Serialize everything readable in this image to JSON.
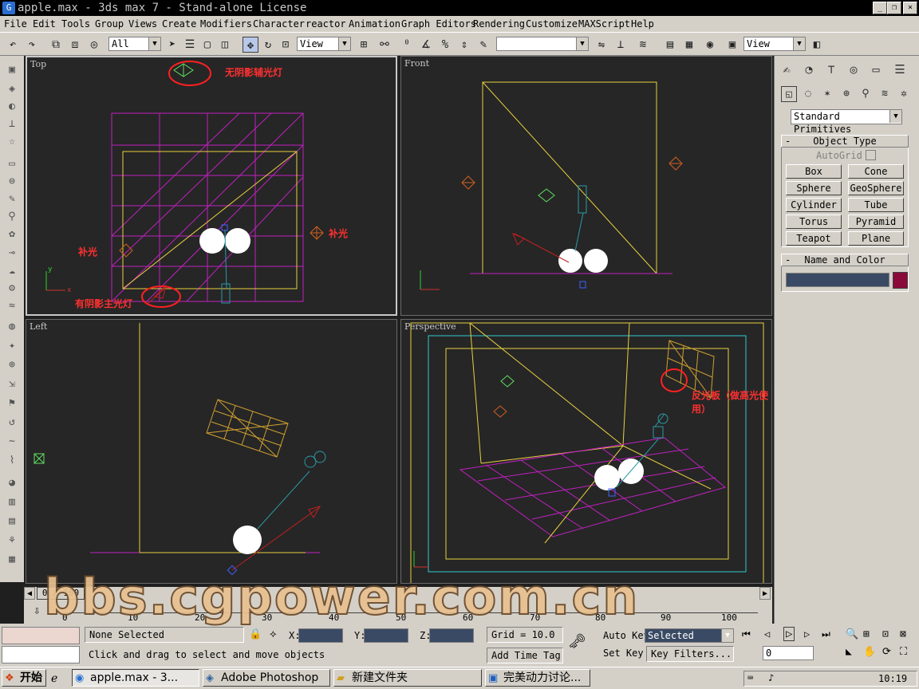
{
  "window": {
    "title": "apple.max - 3ds max 7  - Stand-alone License",
    "controls": {
      "minimize": "_",
      "restore": "❐",
      "close": "×"
    }
  },
  "menu": [
    "File",
    "Edit",
    "Tools",
    "Group",
    "Views",
    "Create",
    "Modifiers",
    "Character",
    "reactor",
    "Animation",
    "Graph Editors",
    "Rendering",
    "Customize",
    "MAXScript",
    "Help"
  ],
  "toolbar": {
    "selection_filter": "All",
    "ref_coord_1": "View",
    "named_selection": "",
    "ref_coord_2": "View"
  },
  "viewports": {
    "top": {
      "label": "Top"
    },
    "front": {
      "label": "Front"
    },
    "left": {
      "label": "Left"
    },
    "perspective": {
      "label": "Perspective"
    }
  },
  "annotations": {
    "no_shadow_fill": "无阴影辅光灯",
    "fill_right": "补光",
    "fill_left": "补光",
    "shadow_key": "有阴影主光灯",
    "reflector": "反光板（做高光使用）"
  },
  "command_panel": {
    "category": "Standard Primitives",
    "object_type": {
      "title": "Object Type",
      "autogrid": "AutoGrid",
      "buttons": [
        "Box",
        "Cone",
        "Sphere",
        "GeoSphere",
        "Cylinder",
        "Tube",
        "Torus",
        "Pyramid",
        "Teapot",
        "Plane"
      ]
    },
    "name_and_color": {
      "title": "Name and Color",
      "name_value": "",
      "color": "#8b0a3a"
    }
  },
  "timeline": {
    "frame_display": "0 / 100",
    "ticks": [
      "0",
      "10",
      "20",
      "30",
      "40",
      "50",
      "60",
      "70",
      "80",
      "90",
      "100"
    ]
  },
  "status": {
    "selection": "None Selected",
    "prompt": "Click and drag to select and move objects",
    "x_label": "X:",
    "y_label": "Y:",
    "z_label": "Z:",
    "grid": "Grid = 10.0",
    "add_time_tag": "Add Time Tag",
    "auto_key": "Auto Key",
    "set_key": "Set Key",
    "key_mode": "Selected",
    "key_filters": "Key Filters...",
    "current_frame": "0"
  },
  "watermark": "bbs.cgpower.com.cn",
  "taskbar": {
    "start": "开始",
    "tasks": [
      "apple.max - 3...",
      "Adobe Photoshop",
      "新建文件夹",
      "完美动力讨论..."
    ],
    "clock": "10:19"
  }
}
